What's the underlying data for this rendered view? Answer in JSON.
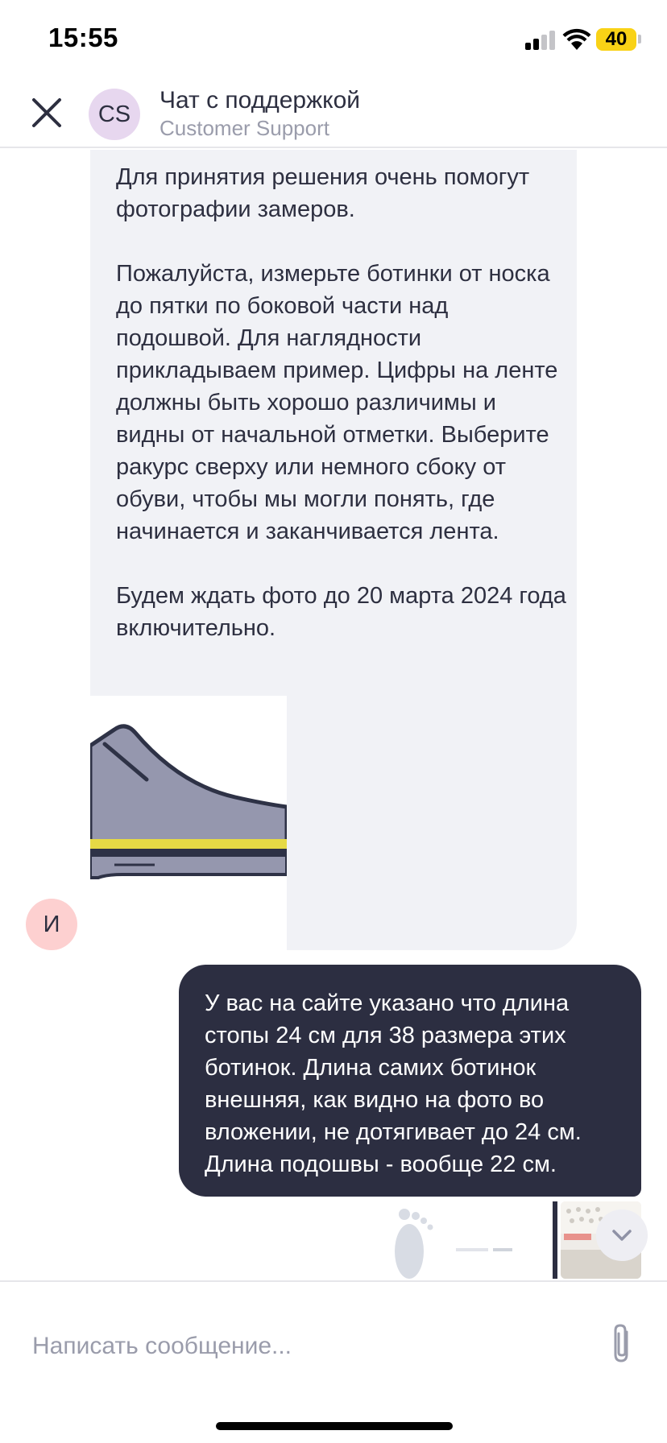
{
  "status_bar": {
    "time": "15:55",
    "battery": "40",
    "battery_color": "#f9d216"
  },
  "header": {
    "close_icon": "close-icon",
    "avatar_initials": "CS",
    "avatar_color": "#e7d7ef",
    "title": "Чат с поддержкой",
    "subtitle": "Customer Support"
  },
  "messages": {
    "support": {
      "paragraphs": [
        "Для принятия решения очень помогут фотографии замеров.",
        "Пожалуйста, измерьте ботинки от носка до пятки по боковой части над подошвой. Для наглядности прикладываем пример. Цифры на ленте должны быть хорошо различимы и видны от начальной отметки. Выберите ракурс сверху или немного сбоку от обуви, чтобы мы могли понять, где начинается и заканчивается лента.",
        "Будем ждать фото до 20 марта 2024 года включительно."
      ],
      "image_icon": "shoe-illustration",
      "bubble_color": "#f1f2f6"
    },
    "sender_avatar": {
      "initial": "И",
      "color": "#fdd0d0"
    },
    "user": {
      "text": "У вас на сайте указано что длина стопы 24 см для 38 размера этих ботинок. Длина самих ботинок внешняя, как видно на фото во вложении, не дотягивает до 24 см. Длина подошвы - вообще 22 см.",
      "bubble_color": "#2c2e41"
    },
    "attachments": [
      "insole-photo",
      "shoe-sole-photo"
    ],
    "scroll_down_icon": "chevron-down-icon"
  },
  "input": {
    "placeholder": "Написать сообщение...",
    "value": "",
    "attach_icon": "paperclip-icon"
  }
}
